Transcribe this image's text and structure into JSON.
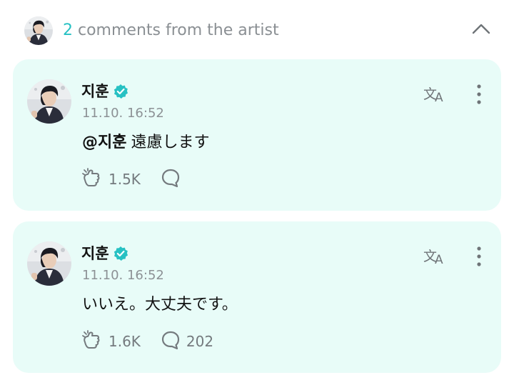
{
  "header": {
    "comment_count": "2",
    "label": "comments from the artist"
  },
  "comments": [
    {
      "author": "지훈",
      "timestamp": "11.10. 16:52",
      "mention": "@지훈",
      "text": "遠慮します",
      "likes": "1.5K",
      "replies": ""
    },
    {
      "author": "지훈",
      "timestamp": "11.10. 16:52",
      "mention": "",
      "text": "いいえ。大丈夫です。",
      "likes": "1.6K",
      "replies": "202"
    }
  ],
  "icons": {
    "collapse": "chevron-up-icon",
    "verified": "verified-badge-icon",
    "translate": "translate-icon",
    "more": "more-vertical-icon",
    "like": "cheer-hand-icon",
    "reply": "comment-bubble-icon"
  },
  "colors": {
    "accent": "#27c1c3",
    "card_background": "#e8fcf8",
    "muted_text": "#8a8f93",
    "icon": "#747a7e"
  }
}
